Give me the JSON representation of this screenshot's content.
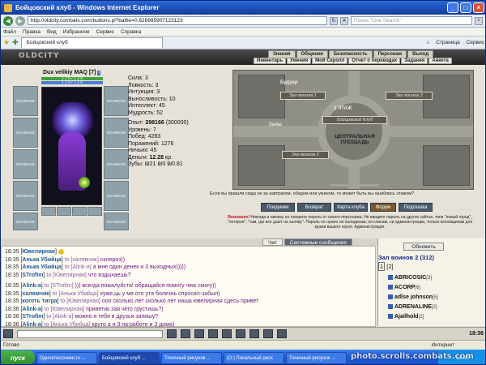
{
  "window": {
    "title": "Бойцовский клуб - Windows Internet Explorer"
  },
  "browser": {
    "url": "http://oldcity.combats.com/buttons.pl?battle=0.628985907123123",
    "search_placeholder": "Поиск \"Live Search\"",
    "menu": [
      "Файл",
      "Правка",
      "Вид",
      "Избранное",
      "Сервис",
      "Справка"
    ],
    "tab_label": "Бойцовский клуб",
    "tools": [
      "Страница",
      "Сервис"
    ]
  },
  "game": {
    "logo": "OLDCITY",
    "top_nav": [
      "Знания",
      "Общение",
      "Безопасность",
      "Персонаж",
      "Выход"
    ],
    "sub_nav": [
      "Инвентарь",
      "Умения",
      "Мой Скролл",
      "Отчет о переводах",
      "Задания",
      "Анкета"
    ],
    "character": {
      "name": "Dux velikiy MAQ",
      "level": "[7]",
      "hp": "1 2 6 / 1 2 6",
      "mp": "1 2 0 / 1 2 0"
    },
    "slot_label": "NO IMAGE",
    "stats": {
      "lines": [
        "Сила: 3",
        "Ловкость: 3",
        "Интуиция: 3",
        "Выносливость: 10",
        "Интеллект: 45",
        "Мудрость: 52"
      ],
      "exp_label": "Опыт:",
      "exp_value": "298166",
      "exp_next": "(300000)",
      "level_line": "Уровень: 7",
      "wins": "Побед: 4283",
      "losses": "Поражений: 1276",
      "draws": "Ничьих: 45",
      "money_label": "Деньги:",
      "money_value": "12.28",
      "money_unit": "кр.",
      "teeth": "Зубы: ₪21 ₪0 ₪0.81"
    },
    "map": {
      "labels": [
        "Будуар",
        "Зал воинов 1",
        "Зал воинов 3",
        "Залы",
        "Зал воинов 2",
        "Бойцовский Клуб"
      ],
      "floor": "2 ЭТАЖ",
      "square": "ЦЕНТРАЛЬНАЯ ПЛОЩАДЬ"
    },
    "map_tip": "Если вы пришли сюда не за завтраком, обедом или ужином, то может быть вы ошиблись этажом?",
    "buttons": [
      "Поединки",
      "Возврат",
      "Карта клуба",
      "Форум",
      "Подсказка"
    ],
    "warning": {
      "bold": "Внимание!",
      "text": "Никогда и никому не говорите пароль от своего персонажа. Не вводите пароль на других сайтах, типа \"новый город\", \"лотерея\", \"там, где все дают на халяву\". Пароль не нужен ни паладинам, ни кланам, ни администрации, только взломщикам для кражи вашего героя. Администрация."
    },
    "chat_tabs": [
      "Чат",
      "Системные сообщения"
    ],
    "chat": [
      {
        "time": "18:35",
        "name": "Ювелирная",
        "to": "",
        "msg": ""
      },
      {
        "time": "18:35",
        "name": "Анька Убийца",
        "to": "to [халямчик]",
        "msg": "склероз))"
      },
      {
        "time": "18:35",
        "name": "Анька Убийца",
        "to": "to [Alink-a]",
        "msg": "а мне один денек и 3 выходных)))))"
      },
      {
        "time": "18:35",
        "name": "STrofim",
        "to": "to [Ювелирная]",
        "msg": "что вздыхаешь?"
      },
      {
        "time": "18:35",
        "name": "Alink-a",
        "to": "to [STrofim]",
        "msg": "))) всегда пожалуйста! обращайся помогу чем смогу))"
      },
      {
        "time": "18:35",
        "name": "халямчик",
        "to": "to [Анька Убийца]",
        "msg": "хуже,ць у мя ото ута болезнь спросил-забыл)"
      },
      {
        "time": "18:35",
        "name": "коготь тигра",
        "to": "to [Ювелирная]",
        "msg": "ооо сколько лет сколько лет наша ювелирная сдесь привет"
      },
      {
        "time": "18:36",
        "name": "Alink-a",
        "to": "to [Ювелирная]",
        "msg": "приветик зая чего грустишь?)"
      },
      {
        "time": "18:36",
        "name": "STrofim",
        "to": "to [Alink-a]",
        "msg": "можно я тебя в друзья запишу?"
      },
      {
        "time": "18:36",
        "name": "Alink-a",
        "to": "to [Анька Убийца]",
        "msg": "круто а я 3 на работе и 3 дома)"
      }
    ],
    "room": {
      "refresh": "Обновить",
      "title": "Зал воинов 2 (312)",
      "pages": [
        "1",
        "2"
      ],
      "players": [
        {
          "name": "ABRICOSIC",
          "level": "[3]"
        },
        {
          "name": "ACORP",
          "level": "[6]"
        },
        {
          "name": "adlse johnson",
          "level": "[5]"
        },
        {
          "name": "ADRENALINE",
          "level": "[2]"
        },
        {
          "name": "Ajailhold",
          "level": "[2]"
        }
      ]
    },
    "clock": "18:36"
  },
  "status": {
    "left": "Готово",
    "zone": "Интернет"
  },
  "taskbar": {
    "start": "пуск",
    "tasks": [
      "Одноклассники.ru ...",
      "Бойцовский клуб ...",
      "Точечный рисунок ...",
      "(D:) Локальный диск",
      "Точечный рисунок ..."
    ],
    "tray": "18:36"
  },
  "watermark": "photo.scrolls.combats.com"
}
